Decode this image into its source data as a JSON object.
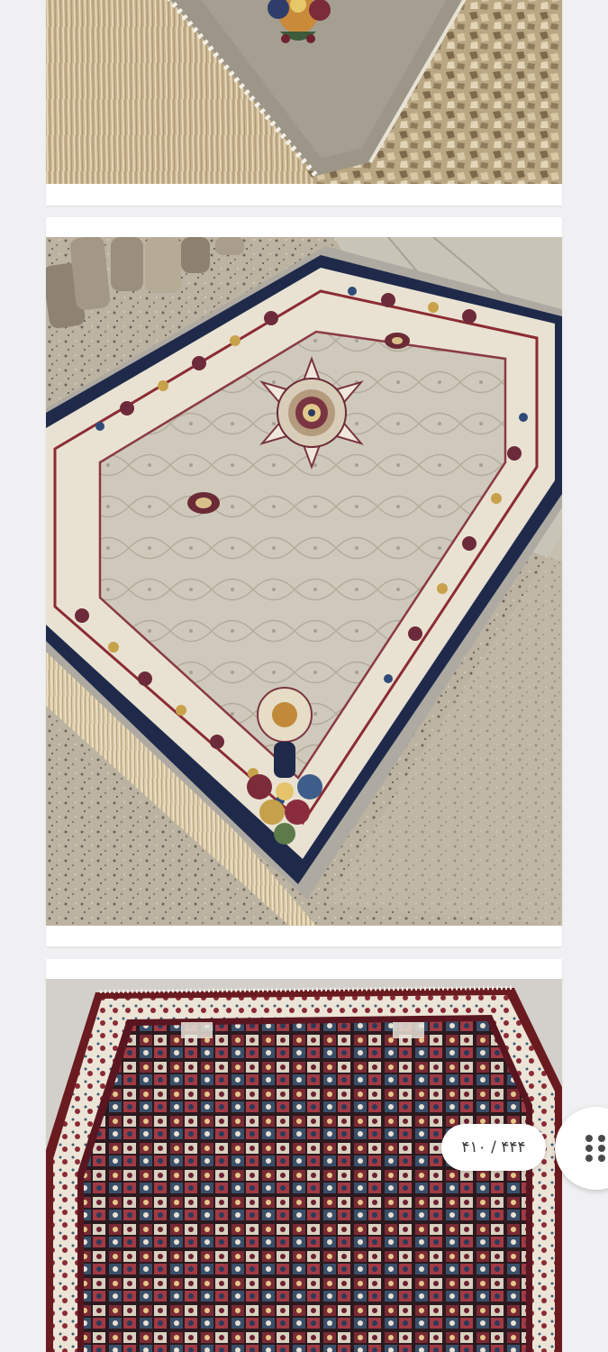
{
  "gallery": {
    "images": [
      {
        "name": "carpet-photo-fringe-closeup",
        "alt": ""
      },
      {
        "name": "carpet-photo-medallion-rug",
        "alt": ""
      },
      {
        "name": "carpet-photo-panel-pattern-rug",
        "alt": ""
      }
    ],
    "counter_text": "۴۴۴ / ۴۱۰",
    "menu_icon": "grid-dots-icon"
  },
  "colors": {
    "page_background": "#f0f0f2",
    "card_background": "#ffffff",
    "navy_border": "#1f2a4a",
    "cream_field": "#d9d3c4",
    "maroon_border": "#6a1b1f"
  }
}
